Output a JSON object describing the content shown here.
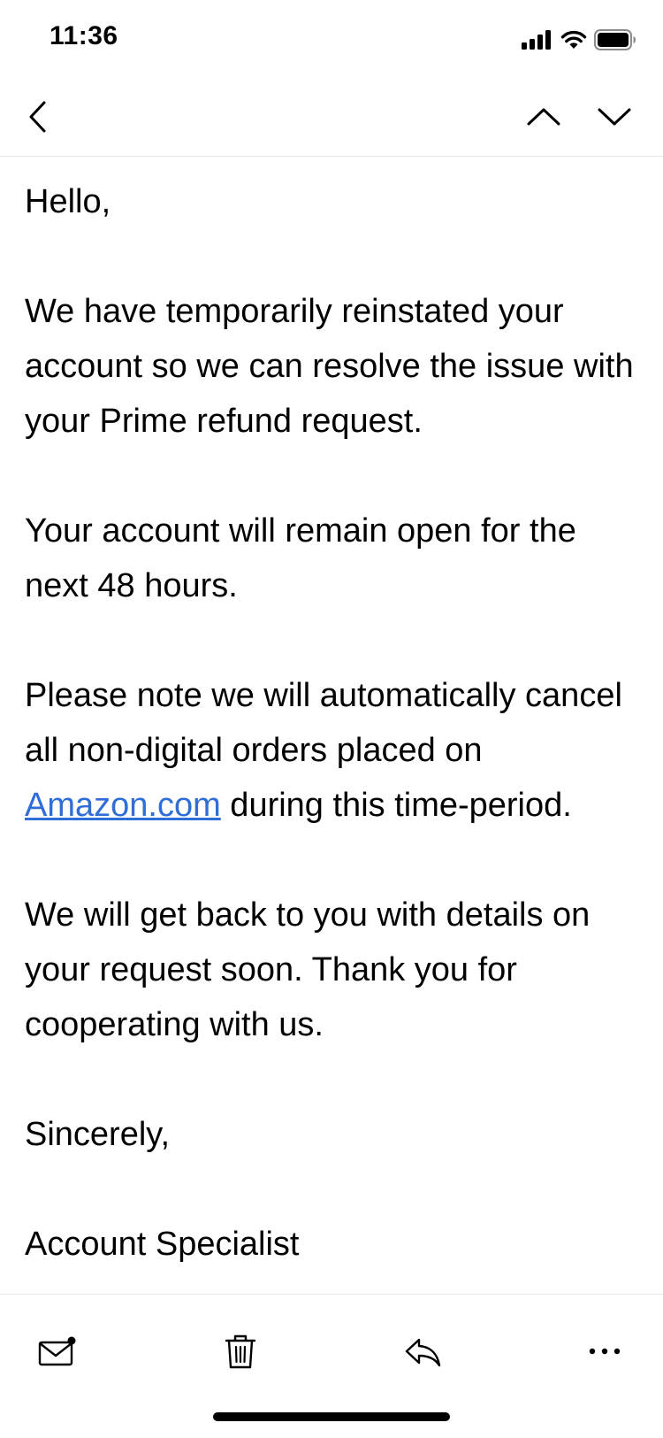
{
  "status_bar": {
    "time": "11:36",
    "icons": [
      "cellular-signal-icon",
      "wifi-icon",
      "battery-icon"
    ]
  },
  "nav": {
    "back_icon": "chevron-left-icon",
    "prev_icon": "chevron-up-icon",
    "next_icon": "chevron-down-icon"
  },
  "email": {
    "greeting": "Hello,",
    "p1": "We have temporarily reinstated your account so we can resolve the issue with your Prime refund request.",
    "p2": "Your account will remain open for the next 48 hours.",
    "p3_before": "Please note we will automatically cancel all non-digital orders placed on ",
    "p3_link": "Amazon.com",
    "p3_after": " during this time-period.",
    "p4": "We will get back to you with details on your request soon. Thank you for cooperating with us.",
    "closing": "Sincerely,",
    "signature": "Account Specialist"
  },
  "toolbar": {
    "icons": [
      "mail-unread-icon",
      "trash-icon",
      "reply-icon",
      "more-icon"
    ]
  },
  "colors": {
    "link": "#2f6ed8",
    "divider": "#e6e6e6"
  }
}
